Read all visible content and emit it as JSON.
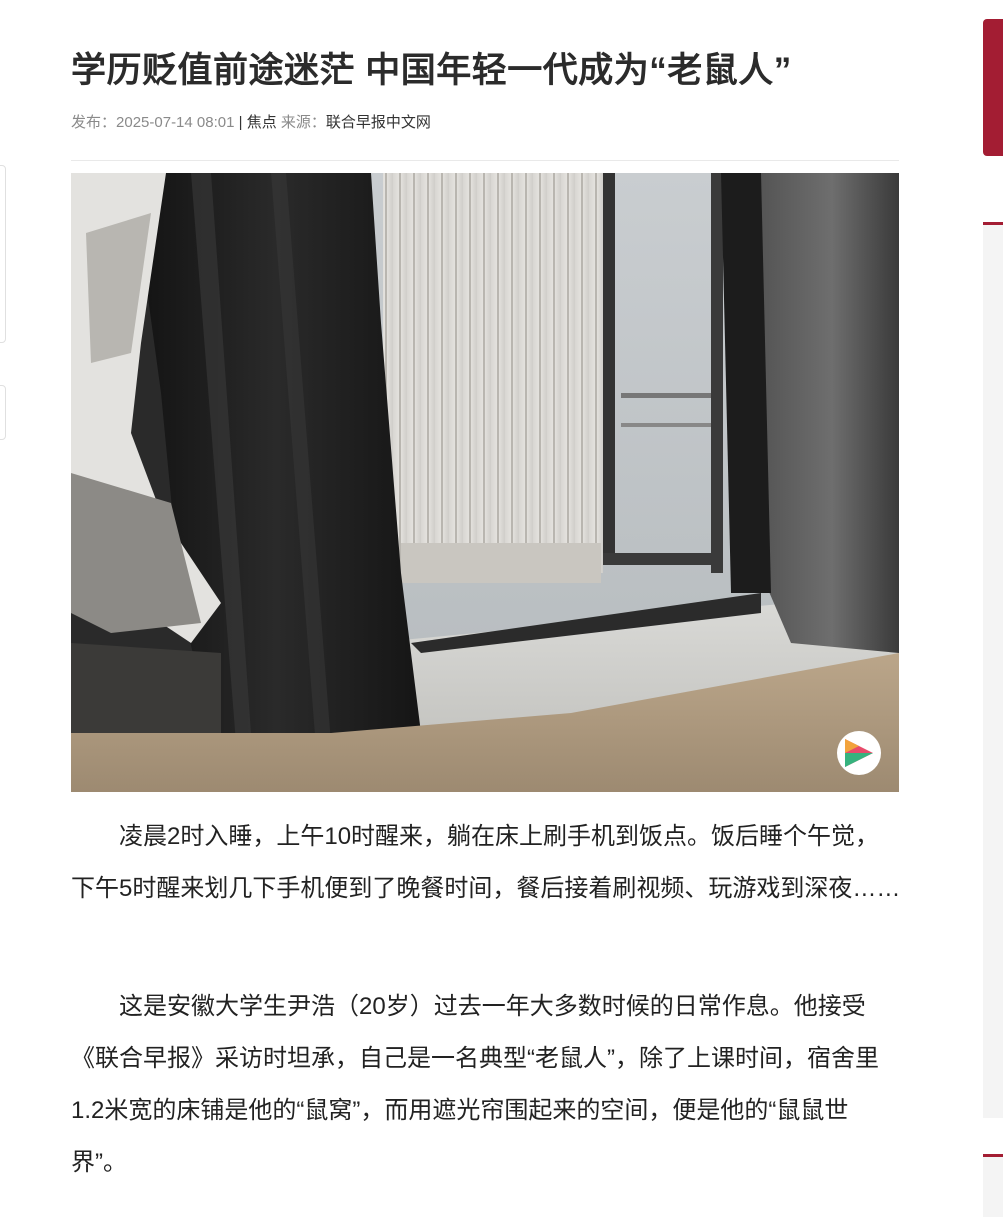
{
  "article": {
    "title": "学历贬值前途迷茫 中国年轻一代成为“老鼠人”",
    "meta": {
      "published_label": "发布：",
      "datetime": "2025-07-14 08:01",
      "separator": " | ",
      "category": "焦点",
      "source_label": " 来源：",
      "source": "联合早报中文网"
    },
    "photo": {
      "watermark_icon": "colorful-triangle-logo-icon"
    },
    "paragraphs": [
      "凌晨2时入睡，上午10时醒来，躺在床上刷手机到饭点。饭后睡个午觉，下午5时醒来划几下手机便到了晚餐时间，餐后接着刷视频、玩游戏到深夜……",
      "这是安徽大学生尹浩（20岁）过去一年大多数时候的日常作息。他接受《联合早报》采访时坦承，自己是一名典型“老鼠人”，除了上课时间，宿舍里1.2米宽的床铺是他的“鼠窝”，而用遮光帘围起来的空间，便是他的“鼠鼠世界”。"
    ]
  },
  "colors": {
    "accent": "#a31d33",
    "text": "#222222",
    "meta_text": "#8a8a8a"
  }
}
